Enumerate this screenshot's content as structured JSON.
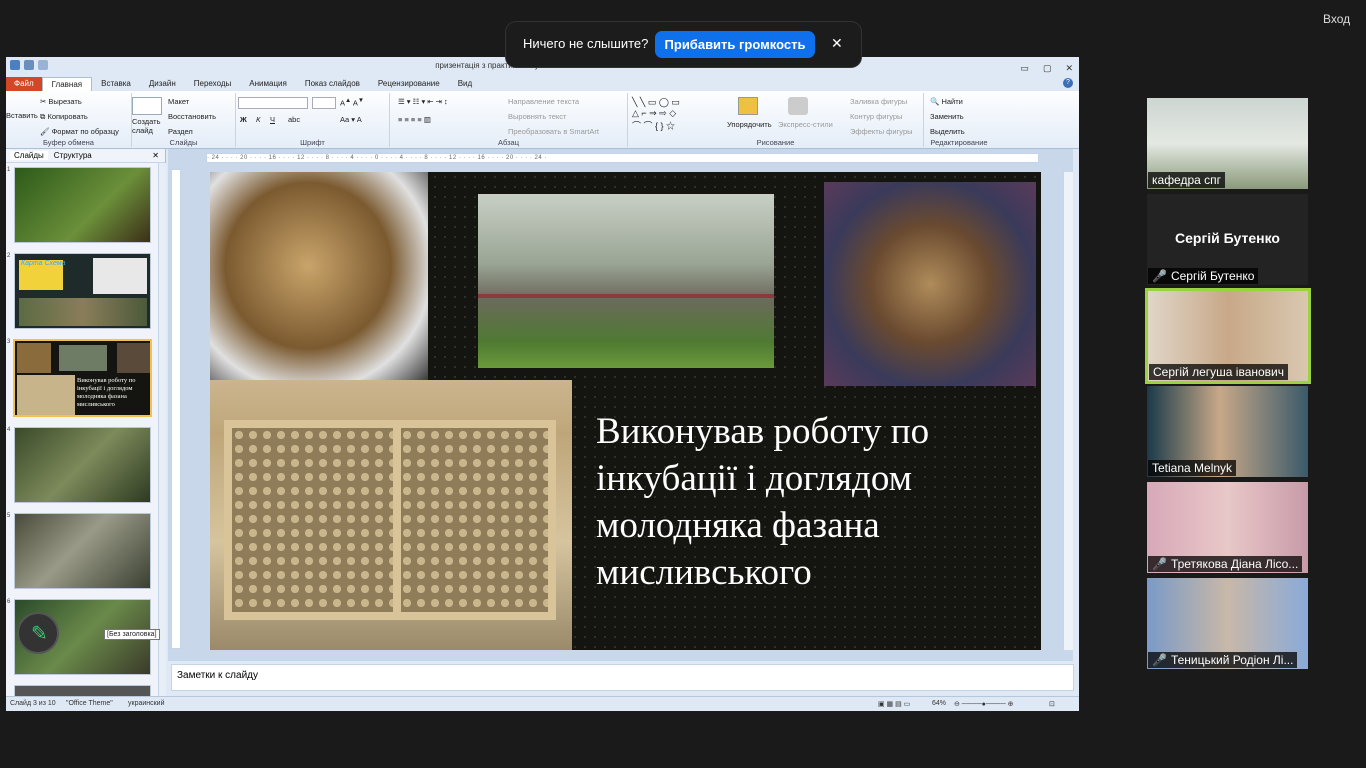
{
  "window": {
    "title": "призентація з практики легуша са... - Microsoft PowerPoint"
  },
  "ribbon_tabs": [
    "Файл",
    "Главная",
    "Вставка",
    "Дизайн",
    "Переходы",
    "Анимация",
    "Показ слайдов",
    "Рецензирование",
    "Вид"
  ],
  "ribbon": {
    "paste": "Вставить",
    "cut": "Вырезать",
    "copy": "Копировать",
    "format_painter": "Формат по образцу",
    "new_slide": "Создать слайд",
    "layout": "Макет",
    "reset": "Восстановить",
    "section": "Раздел",
    "text_direction": "Направление текста",
    "align_text": "Выровнять текст",
    "smartart": "Преобразовать в SmartArt",
    "arrange": "Упорядочить",
    "quick_styles": "Экспресс-стили",
    "shape_fill": "Заливка фигуры",
    "shape_outline": "Контур фигуры",
    "shape_effects": "Эффекты фигуры",
    "find": "Найти",
    "replace": "Заменить",
    "select": "Выделить",
    "groups": {
      "clipboard": "Буфер обмена",
      "slides": "Слайды",
      "font": "Шрифт",
      "paragraph": "Абзац",
      "drawing": "Рисование",
      "editing": "Редактирование"
    }
  },
  "side_panel": {
    "tabs": [
      "Слайды",
      "Структура"
    ],
    "slide_numbers": [
      "1",
      "2",
      "3",
      "4",
      "5",
      "6"
    ],
    "thumb2_title": "Карта Схема",
    "thumb3_caption": "Виконував роботу по інкубації і доглядом молодняка фазана мисливського"
  },
  "ruler": "· 24 · · · · 20 · · · · 16 · · · · 12 · · · · 8 · · · · 4 · · · · 0 · · · · 4 · · · · 8 · · · · 12 · · · · 16 · · · · 20 · · · · 24 ·",
  "slide": {
    "text": "Виконував роботу по інкубації і доглядом молодняка фазана мисливського"
  },
  "notes_placeholder": "Заметки к слайду",
  "tooltip": "Без заголовка",
  "status": {
    "slide_counter": "Слайд 3 из 10",
    "theme": "\"Office Theme\"",
    "language": "украинский",
    "zoom": "64%"
  },
  "zoom_banner": {
    "message": "Ничего не слышите?",
    "button": "Прибавить громкость"
  },
  "enter_label": "Вход",
  "participants": [
    {
      "name": "кафедра спг",
      "muted": false
    },
    {
      "name": "Сергій Бутенко",
      "display": "Сергій Бутенко",
      "muted": true
    },
    {
      "name": "Сергій легуша іванович",
      "muted": false
    },
    {
      "name": "Tetiana Melnyk",
      "muted": false
    },
    {
      "name": "Третякова Діана  Лісо...",
      "muted": true
    },
    {
      "name": "Теницький Родіон Лі...",
      "muted": true
    }
  ],
  "colors": {
    "accent": "#0e71eb",
    "active_speaker": "#9bd33e",
    "muted": "#e02828",
    "file_tab": "#d24726"
  }
}
